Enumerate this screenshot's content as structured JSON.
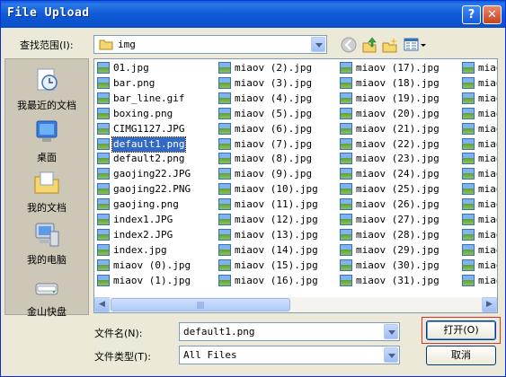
{
  "window": {
    "title": "File Upload",
    "help_glyph": "?",
    "close_glyph": "✕"
  },
  "lookin": {
    "label": "查找范围(I):",
    "folder": "img"
  },
  "places": [
    {
      "label": "我最近的文档",
      "icon": "recent-documents-icon"
    },
    {
      "label": "桌面",
      "icon": "desktop-icon"
    },
    {
      "label": "我的文档",
      "icon": "my-documents-icon"
    },
    {
      "label": "我的电脑",
      "icon": "my-computer-icon"
    },
    {
      "label": "金山快盘",
      "icon": "kuaipan-drive-icon"
    }
  ],
  "files": {
    "col1": [
      "01.jpg",
      "bar.png",
      "bar_line.gif",
      "boxing.png",
      "CIMG1127.JPG",
      "default1.png",
      "default2.png",
      "gaojing22.JPG",
      "gaojing22.PNG",
      "gaojing.png",
      "index1.JPG",
      "index2.JPG",
      "index.jpg",
      "miaov (0).jpg",
      "miaov (1).jpg"
    ],
    "col2": [
      "miaov (2).jpg",
      "miaov (3).jpg",
      "miaov (4).jpg",
      "miaov (5).jpg",
      "miaov (6).jpg",
      "miaov (7).jpg",
      "miaov (8).jpg",
      "miaov (9).jpg",
      "miaov (10).jpg",
      "miaov (11).jpg",
      "miaov (12).jpg",
      "miaov (13).jpg",
      "miaov (14).jpg",
      "miaov (15).jpg",
      "miaov (16).jpg"
    ],
    "col3": [
      "miaov (17).jpg",
      "miaov (18).jpg",
      "miaov (19).jpg",
      "miaov (20).jpg",
      "miaov (21).jpg",
      "miaov (22).jpg",
      "miaov (23).jpg",
      "miaov (24).jpg",
      "miaov (25).jpg",
      "miaov (26).jpg",
      "miaov (27).jpg",
      "miaov (28).jpg",
      "miaov (29).jpg",
      "miaov (30).jpg",
      "miaov (31).jpg"
    ],
    "col4": [
      "miao",
      "miao",
      "miao",
      "miao",
      "miao",
      "miao",
      "miao",
      "miao",
      "miao",
      "miao",
      "miao",
      "miao",
      "miao",
      "miao",
      "miao"
    ],
    "selected": "default1.png"
  },
  "filename": {
    "label": "文件名(N):",
    "value": "default1.png"
  },
  "filetype": {
    "label": "文件类型(T):",
    "value": "All Files"
  },
  "buttons": {
    "open": "打开(O)",
    "cancel": "取消"
  },
  "colors": {
    "titlebar": "#0b4fc9",
    "selection": "#316ac5",
    "highlight_frame": "#e03030"
  }
}
